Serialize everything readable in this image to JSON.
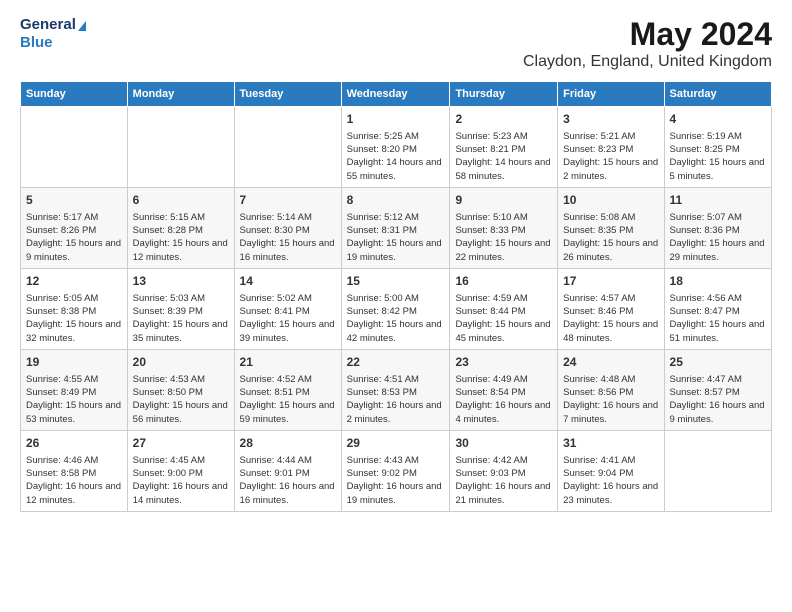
{
  "header": {
    "logo_line1": "General",
    "logo_line2": "Blue",
    "month_title": "May 2024",
    "location": "Claydon, England, United Kingdom"
  },
  "days_of_week": [
    "Sunday",
    "Monday",
    "Tuesday",
    "Wednesday",
    "Thursday",
    "Friday",
    "Saturday"
  ],
  "weeks": [
    [
      {
        "day": "",
        "sunrise": "",
        "sunset": "",
        "daylight": ""
      },
      {
        "day": "",
        "sunrise": "",
        "sunset": "",
        "daylight": ""
      },
      {
        "day": "",
        "sunrise": "",
        "sunset": "",
        "daylight": ""
      },
      {
        "day": "1",
        "sunrise": "Sunrise: 5:25 AM",
        "sunset": "Sunset: 8:20 PM",
        "daylight": "Daylight: 14 hours and 55 minutes."
      },
      {
        "day": "2",
        "sunrise": "Sunrise: 5:23 AM",
        "sunset": "Sunset: 8:21 PM",
        "daylight": "Daylight: 14 hours and 58 minutes."
      },
      {
        "day": "3",
        "sunrise": "Sunrise: 5:21 AM",
        "sunset": "Sunset: 8:23 PM",
        "daylight": "Daylight: 15 hours and 2 minutes."
      },
      {
        "day": "4",
        "sunrise": "Sunrise: 5:19 AM",
        "sunset": "Sunset: 8:25 PM",
        "daylight": "Daylight: 15 hours and 5 minutes."
      }
    ],
    [
      {
        "day": "5",
        "sunrise": "Sunrise: 5:17 AM",
        "sunset": "Sunset: 8:26 PM",
        "daylight": "Daylight: 15 hours and 9 minutes."
      },
      {
        "day": "6",
        "sunrise": "Sunrise: 5:15 AM",
        "sunset": "Sunset: 8:28 PM",
        "daylight": "Daylight: 15 hours and 12 minutes."
      },
      {
        "day": "7",
        "sunrise": "Sunrise: 5:14 AM",
        "sunset": "Sunset: 8:30 PM",
        "daylight": "Daylight: 15 hours and 16 minutes."
      },
      {
        "day": "8",
        "sunrise": "Sunrise: 5:12 AM",
        "sunset": "Sunset: 8:31 PM",
        "daylight": "Daylight: 15 hours and 19 minutes."
      },
      {
        "day": "9",
        "sunrise": "Sunrise: 5:10 AM",
        "sunset": "Sunset: 8:33 PM",
        "daylight": "Daylight: 15 hours and 22 minutes."
      },
      {
        "day": "10",
        "sunrise": "Sunrise: 5:08 AM",
        "sunset": "Sunset: 8:35 PM",
        "daylight": "Daylight: 15 hours and 26 minutes."
      },
      {
        "day": "11",
        "sunrise": "Sunrise: 5:07 AM",
        "sunset": "Sunset: 8:36 PM",
        "daylight": "Daylight: 15 hours and 29 minutes."
      }
    ],
    [
      {
        "day": "12",
        "sunrise": "Sunrise: 5:05 AM",
        "sunset": "Sunset: 8:38 PM",
        "daylight": "Daylight: 15 hours and 32 minutes."
      },
      {
        "day": "13",
        "sunrise": "Sunrise: 5:03 AM",
        "sunset": "Sunset: 8:39 PM",
        "daylight": "Daylight: 15 hours and 35 minutes."
      },
      {
        "day": "14",
        "sunrise": "Sunrise: 5:02 AM",
        "sunset": "Sunset: 8:41 PM",
        "daylight": "Daylight: 15 hours and 39 minutes."
      },
      {
        "day": "15",
        "sunrise": "Sunrise: 5:00 AM",
        "sunset": "Sunset: 8:42 PM",
        "daylight": "Daylight: 15 hours and 42 minutes."
      },
      {
        "day": "16",
        "sunrise": "Sunrise: 4:59 AM",
        "sunset": "Sunset: 8:44 PM",
        "daylight": "Daylight: 15 hours and 45 minutes."
      },
      {
        "day": "17",
        "sunrise": "Sunrise: 4:57 AM",
        "sunset": "Sunset: 8:46 PM",
        "daylight": "Daylight: 15 hours and 48 minutes."
      },
      {
        "day": "18",
        "sunrise": "Sunrise: 4:56 AM",
        "sunset": "Sunset: 8:47 PM",
        "daylight": "Daylight: 15 hours and 51 minutes."
      }
    ],
    [
      {
        "day": "19",
        "sunrise": "Sunrise: 4:55 AM",
        "sunset": "Sunset: 8:49 PM",
        "daylight": "Daylight: 15 hours and 53 minutes."
      },
      {
        "day": "20",
        "sunrise": "Sunrise: 4:53 AM",
        "sunset": "Sunset: 8:50 PM",
        "daylight": "Daylight: 15 hours and 56 minutes."
      },
      {
        "day": "21",
        "sunrise": "Sunrise: 4:52 AM",
        "sunset": "Sunset: 8:51 PM",
        "daylight": "Daylight: 15 hours and 59 minutes."
      },
      {
        "day": "22",
        "sunrise": "Sunrise: 4:51 AM",
        "sunset": "Sunset: 8:53 PM",
        "daylight": "Daylight: 16 hours and 2 minutes."
      },
      {
        "day": "23",
        "sunrise": "Sunrise: 4:49 AM",
        "sunset": "Sunset: 8:54 PM",
        "daylight": "Daylight: 16 hours and 4 minutes."
      },
      {
        "day": "24",
        "sunrise": "Sunrise: 4:48 AM",
        "sunset": "Sunset: 8:56 PM",
        "daylight": "Daylight: 16 hours and 7 minutes."
      },
      {
        "day": "25",
        "sunrise": "Sunrise: 4:47 AM",
        "sunset": "Sunset: 8:57 PM",
        "daylight": "Daylight: 16 hours and 9 minutes."
      }
    ],
    [
      {
        "day": "26",
        "sunrise": "Sunrise: 4:46 AM",
        "sunset": "Sunset: 8:58 PM",
        "daylight": "Daylight: 16 hours and 12 minutes."
      },
      {
        "day": "27",
        "sunrise": "Sunrise: 4:45 AM",
        "sunset": "Sunset: 9:00 PM",
        "daylight": "Daylight: 16 hours and 14 minutes."
      },
      {
        "day": "28",
        "sunrise": "Sunrise: 4:44 AM",
        "sunset": "Sunset: 9:01 PM",
        "daylight": "Daylight: 16 hours and 16 minutes."
      },
      {
        "day": "29",
        "sunrise": "Sunrise: 4:43 AM",
        "sunset": "Sunset: 9:02 PM",
        "daylight": "Daylight: 16 hours and 19 minutes."
      },
      {
        "day": "30",
        "sunrise": "Sunrise: 4:42 AM",
        "sunset": "Sunset: 9:03 PM",
        "daylight": "Daylight: 16 hours and 21 minutes."
      },
      {
        "day": "31",
        "sunrise": "Sunrise: 4:41 AM",
        "sunset": "Sunset: 9:04 PM",
        "daylight": "Daylight: 16 hours and 23 minutes."
      },
      {
        "day": "",
        "sunrise": "",
        "sunset": "",
        "daylight": ""
      }
    ]
  ]
}
